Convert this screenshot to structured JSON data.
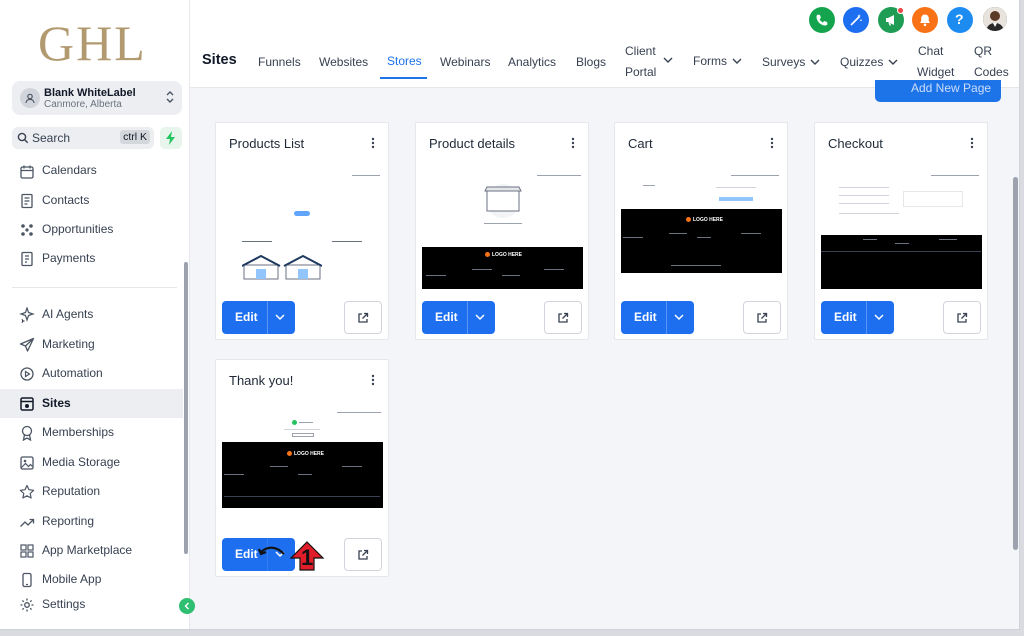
{
  "sidebar": {
    "logo": "GHL",
    "account": {
      "name": "Blank WhiteLabel",
      "location": "Canmore, Alberta"
    },
    "search": {
      "placeholder": "Search",
      "shortcut": "ctrl K"
    },
    "items": [
      {
        "label": "Calendars",
        "icon": "calendar-icon"
      },
      {
        "label": "Contacts",
        "icon": "contacts-icon"
      },
      {
        "label": "Opportunities",
        "icon": "opportunities-icon"
      },
      {
        "label": "Payments",
        "icon": "payments-icon"
      },
      {
        "label": "AI Agents",
        "icon": "sparkle-icon"
      },
      {
        "label": "Marketing",
        "icon": "send-icon"
      },
      {
        "label": "Automation",
        "icon": "automation-icon"
      },
      {
        "label": "Sites",
        "icon": "sites-icon",
        "active": true
      },
      {
        "label": "Memberships",
        "icon": "award-icon"
      },
      {
        "label": "Media Storage",
        "icon": "image-icon"
      },
      {
        "label": "Reputation",
        "icon": "star-icon"
      },
      {
        "label": "Reporting",
        "icon": "trend-icon"
      },
      {
        "label": "App Marketplace",
        "icon": "grid-icon"
      },
      {
        "label": "Mobile App",
        "icon": "mobile-icon"
      },
      {
        "label": "Settings",
        "icon": "gear-icon"
      }
    ]
  },
  "header": {
    "title": "Sites",
    "tabs": [
      {
        "label": "Funnels"
      },
      {
        "label": "Websites"
      },
      {
        "label": "Stores",
        "active": true
      },
      {
        "label": "Webinars"
      },
      {
        "label": "Analytics"
      },
      {
        "label": "Blogs"
      },
      {
        "label_line1": "Client",
        "label_line2": "Portal",
        "dropdown": true
      },
      {
        "label": "Forms",
        "dropdown": true
      },
      {
        "label": "Surveys",
        "dropdown": true
      },
      {
        "label": "Quizzes",
        "dropdown": true
      },
      {
        "label_line1": "Chat",
        "label_line2": "Widget"
      },
      {
        "label_line1": "QR",
        "label_line2": "Codes"
      }
    ],
    "icons": [
      {
        "name": "phone-icon",
        "color": "#14a44d"
      },
      {
        "name": "magic-icon",
        "color": "#1d6ff0"
      },
      {
        "name": "megaphone-icon",
        "color": "#1f9d55"
      },
      {
        "name": "bell-icon",
        "color": "#f97316"
      },
      {
        "name": "help-icon",
        "color": "#1d8cf0"
      }
    ],
    "help_glyph": "?"
  },
  "main": {
    "add_button": "Add New Page",
    "cards": [
      {
        "title": "Products List",
        "edit": "Edit"
      },
      {
        "title": "Product details",
        "edit": "Edit"
      },
      {
        "title": "Cart",
        "edit": "Edit"
      },
      {
        "title": "Checkout",
        "edit": "Edit"
      },
      {
        "title": "Thank you!",
        "edit": "Edit"
      }
    ],
    "annotation_number": "1"
  },
  "colors": {
    "primary": "#1d6ff0",
    "logo": "#b29a70",
    "active_tab": "#1d73e8"
  }
}
